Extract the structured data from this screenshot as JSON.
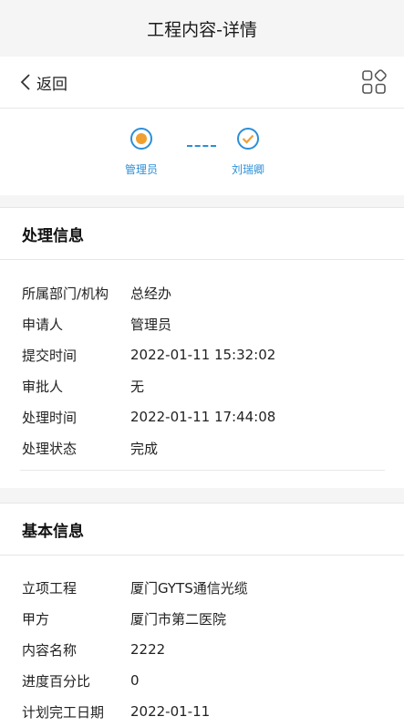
{
  "title": "工程内容-详情",
  "nav": {
    "back_label": "返回"
  },
  "flow": {
    "nodes": [
      {
        "label": "管理员",
        "state": "current"
      },
      {
        "label": "刘瑞卿",
        "state": "done"
      }
    ],
    "accent": "#2b8fd6"
  },
  "processing": {
    "header": "处理信息",
    "rows": [
      {
        "key": "所属部门/机构",
        "value": "总经办"
      },
      {
        "key": "申请人",
        "value": "管理员"
      },
      {
        "key": "提交时间",
        "value": "2022-01-11 15:32:02"
      },
      {
        "key": "审批人",
        "value": "无"
      },
      {
        "key": "处理时间",
        "value": "2022-01-11 17:44:08"
      },
      {
        "key": "处理状态",
        "value": "完成"
      }
    ]
  },
  "basic": {
    "header": "基本信息",
    "rows": [
      {
        "key": "立项工程",
        "value": "厦门GYTS通信光缆"
      },
      {
        "key": "甲方",
        "value": "厦门市第二医院"
      },
      {
        "key": "内容名称",
        "value": "2222"
      },
      {
        "key": "进度百分比",
        "value": "0"
      },
      {
        "key": "计划完工日期",
        "value": "2022-01-11"
      }
    ]
  }
}
